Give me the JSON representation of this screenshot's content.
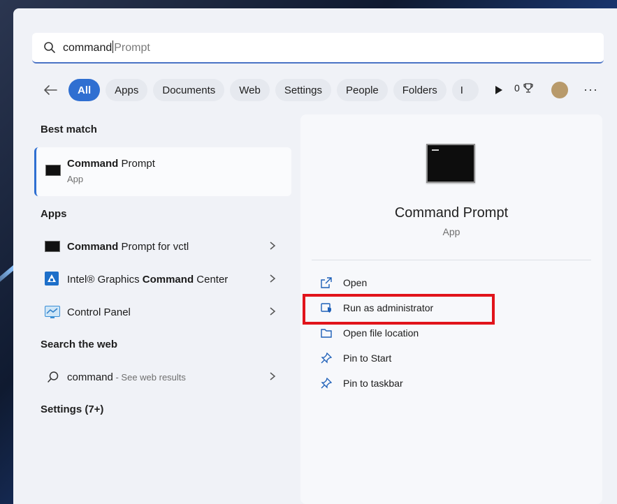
{
  "search": {
    "typed": "command",
    "completion": "Prompt"
  },
  "filters": {
    "chips": [
      {
        "label": "All",
        "active": true
      },
      {
        "label": "Apps",
        "active": false
      },
      {
        "label": "Documents",
        "active": false
      },
      {
        "label": "Web",
        "active": false
      },
      {
        "label": "Settings",
        "active": false
      },
      {
        "label": "People",
        "active": false
      },
      {
        "label": "Folders",
        "active": false
      },
      {
        "label": "I",
        "active": false
      }
    ],
    "points": "0"
  },
  "left": {
    "best_match_title": "Best match",
    "best_match": {
      "name_bold": "Command",
      "name_rest": " Prompt",
      "type": "App"
    },
    "apps_title": "Apps",
    "apps": [
      {
        "pre": "",
        "bold": "Command",
        "post": " Prompt for vctl"
      },
      {
        "pre": "Intel® Graphics ",
        "bold": "Command",
        "post": " Center"
      },
      {
        "pre": "Control Panel",
        "bold": "",
        "post": ""
      }
    ],
    "web_title": "Search the web",
    "web": {
      "query": "command",
      "suffix": " - See web results"
    },
    "settings_title": "Settings (7+)"
  },
  "detail": {
    "name": "Command Prompt",
    "type": "App",
    "actions": [
      {
        "label": "Open",
        "icon": "open-external-icon"
      },
      {
        "label": "Run as administrator",
        "icon": "shield-admin-icon"
      },
      {
        "label": "Open file location",
        "icon": "folder-icon"
      },
      {
        "label": "Pin to Start",
        "icon": "pin-icon"
      },
      {
        "label": "Pin to taskbar",
        "icon": "pin-icon"
      }
    ]
  },
  "colors": {
    "accent": "#2f6fd1",
    "highlight": "#e1141b",
    "panel": "#f0f2f7"
  }
}
